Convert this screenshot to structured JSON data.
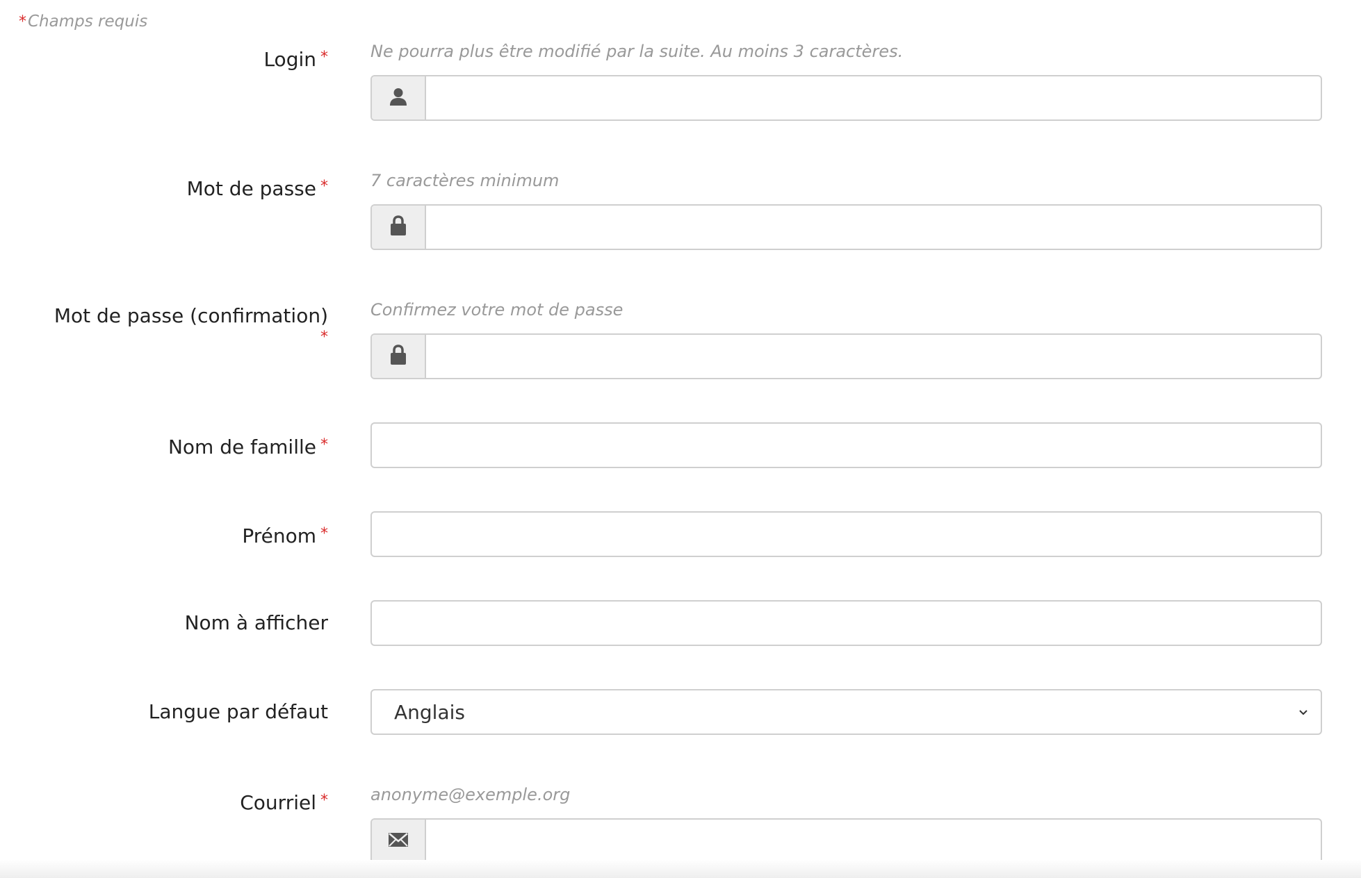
{
  "form": {
    "required_note_star": "*",
    "required_note": "Champs requis",
    "required_marker": "*",
    "fields": {
      "login": {
        "label": "Login",
        "hint": "Ne pourra plus être modifié par la suite. Au moins 3 caractères.",
        "value": "",
        "icon": "user-icon"
      },
      "password": {
        "label": "Mot de passe",
        "hint": "7 caractères minimum",
        "value": "",
        "icon": "lock-icon"
      },
      "password_confirm": {
        "label": "Mot de passe (confirmation)",
        "hint": "Confirmez votre mot de passe",
        "value": "",
        "icon": "lock-icon"
      },
      "last_name": {
        "label": "Nom de famille",
        "value": ""
      },
      "first_name": {
        "label": "Prénom",
        "value": ""
      },
      "display_name": {
        "label": "Nom à afficher",
        "value": ""
      },
      "language": {
        "label": "Langue par défaut",
        "selected": "Anglais",
        "icon": "chevron-down-icon"
      },
      "email": {
        "label": "Courriel",
        "hint": "anonyme@exemple.org",
        "value": "",
        "icon": "envelope-icon"
      }
    }
  },
  "colors": {
    "required": "#d92b2b",
    "hint": "#999999",
    "label": "#222222",
    "border": "#cfcfcf",
    "addon_bg": "#eeeeee",
    "icon": "#555555"
  }
}
